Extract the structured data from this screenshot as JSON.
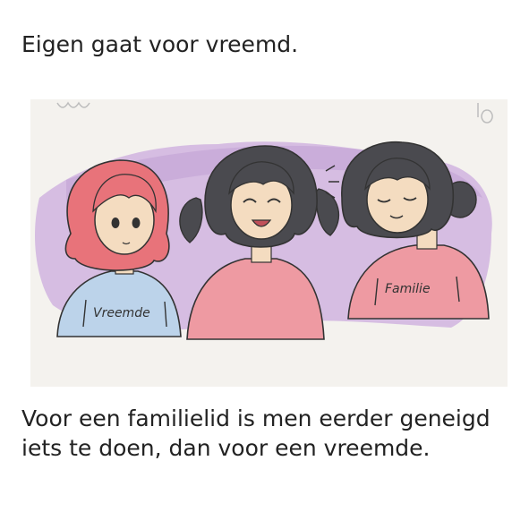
{
  "card": {
    "title": "Eigen gaat voor vreemd.",
    "caption": "Voor een familielid is men eerder geneigd iets te doen, dan voor een vreemde.",
    "illustration": {
      "shirt_left_text": "Vreemde",
      "shirt_right_text": "Familie",
      "background_colors": {
        "paper": "#f4f2ee",
        "purple_shading": "#c9a6dd",
        "pink_hair": "#e8737a",
        "dark_hair": "#4a4a4f",
        "blue_shirt": "#bcd3ea",
        "pink_shirt": "#ee9aa2",
        "skin": "#f4dcc0"
      }
    }
  }
}
